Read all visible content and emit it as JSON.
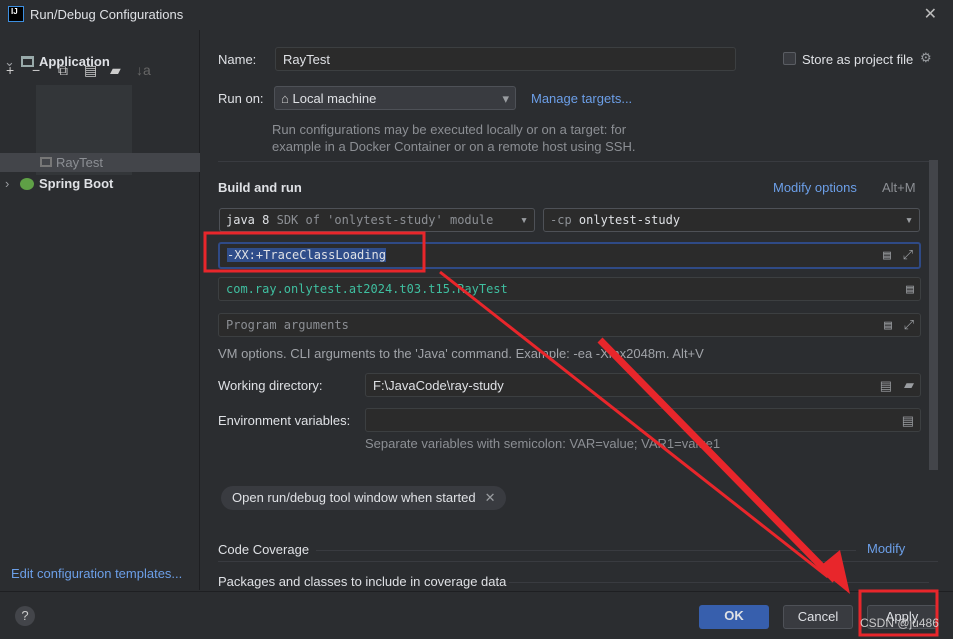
{
  "window": {
    "title": "Run/Debug Configurations",
    "logo": "IJ",
    "close_icon": "close-icon"
  },
  "toolbar": {
    "add": "+",
    "remove": "−",
    "copy": "⧉",
    "save": "▤",
    "folder": "▰",
    "sort": "↓a"
  },
  "tree": {
    "application": "Application",
    "raytest": "RayTest",
    "spring_boot": "Spring Boot"
  },
  "sidebar": {
    "edit_templates": "Edit configuration templates..."
  },
  "form": {
    "name_label": "Name:",
    "name_value": "RayTest",
    "store_label": "Store as project file",
    "runon_label": "Run on:",
    "runon_value": "Local machine",
    "manage_targets": "Manage targets...",
    "runon_hint_1": "Run configurations may be executed locally or on a target: for",
    "runon_hint_2": "example in a Docker Container or on a remote host using SSH.",
    "build_run": "Build and run",
    "modify_options": "Modify options",
    "modify_shortcut": "Alt+M",
    "jdk_bold": "java 8",
    "jdk_rest": "SDK of 'onlytest-study' module",
    "cp_prefix": "-cp",
    "cp_value": "onlytest-study",
    "vm_options": "-XX:+TraceClassLoading",
    "main_class": "com.ray.onlytest.at2024.t03.t15.RayTest",
    "program_args_placeholder": "Program arguments",
    "vm_hint": "VM options. CLI arguments to the 'Java' command. Example: -ea -Xmx2048m. Alt+V",
    "workdir_label": "Working directory:",
    "workdir_value": "F:\\JavaCode\\ray-study",
    "env_label": "Environment variables:",
    "env_hint": "Separate variables with semicolon: VAR=value; VAR1=value1",
    "chip": "Open run/debug tool window when started",
    "coverage": "Code Coverage",
    "coverage_modify": "Modify",
    "packages": "Packages and classes to include in coverage data"
  },
  "footer": {
    "help": "?",
    "ok": "OK",
    "cancel": "Cancel",
    "apply": "Apply"
  },
  "watermark": "CSDN @ju486",
  "colors": {
    "accent": "#375fad",
    "annotation": "#e8262b",
    "link": "#6c9fe8",
    "main_class": "#3fbfa0"
  }
}
